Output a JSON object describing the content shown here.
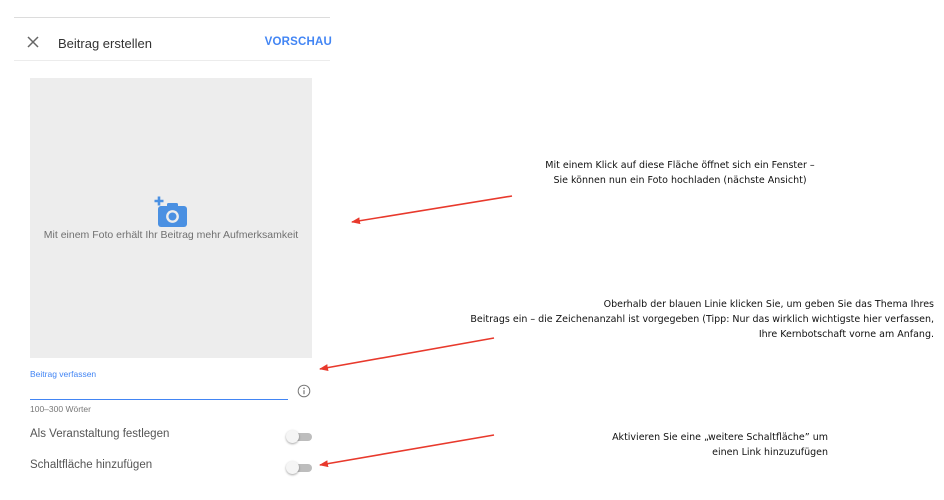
{
  "header": {
    "title": "Beitrag erstellen",
    "preview_label": "VORSCHAU",
    "close_icon": "close-icon"
  },
  "photo": {
    "icon": "add-photo-camera-icon",
    "hint": "Mit einem Foto erhält Ihr Beitrag mehr Aufmerksamkeit"
  },
  "post": {
    "label": "Beitrag verfassen",
    "value": "",
    "word_count": "100–300 Wörter",
    "info_icon": "info-icon"
  },
  "options": {
    "event_label": "Als Veranstaltung festlegen",
    "event_enabled": false,
    "button_label": "Schaltfläche hinzufügen",
    "button_enabled": false
  },
  "annotations": {
    "photo": [
      "Mit einem Klick auf diese Fläche öffnet sich ein Fenster –",
      "Sie können nun ein Foto hochladen (nächste Ansicht)"
    ],
    "topic": [
      "Oberhalb der blauen Linie klicken Sie, um geben Sie das Thema Ihres",
      "Beitrags ein – die Zeichenanzahl ist vorgegeben (Tipp: Nur das wirklich wichtigste hier verfassen,",
      "Ihre Kernbotschaft vorne am Anfang."
    ],
    "button": [
      "Aktivieren Sie eine „weitere Schaltfläche” um",
      "einen Link hinzuzufügen"
    ]
  },
  "colors": {
    "accent": "#4285f4",
    "arrow": "#e8392c",
    "photo_area": "#ededed"
  }
}
